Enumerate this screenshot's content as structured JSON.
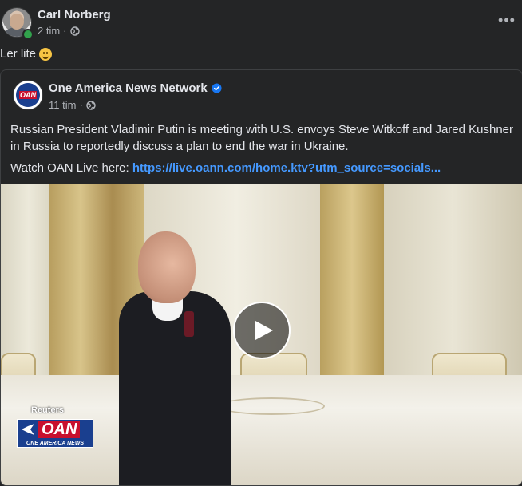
{
  "post": {
    "author_name": "Carl Norberg",
    "time": "2 tim",
    "separator": "·",
    "text": "Ler lite",
    "more_label": "•••"
  },
  "shared": {
    "page_name": "One America News Network",
    "time": "11 tim",
    "separator": "·",
    "body_text": "Russian President Vladimir Putin is meeting with U.S. envoys Steve Witkoff and Jared Kushner in Russia to reportedly discuss a plan to end the war in Ukraine.",
    "watch_prefix": "Watch OAN Live here: ",
    "link_text": "https://live.oann.com/home.ktv?utm_source=socials...",
    "avatar_text": "OAN"
  },
  "video": {
    "source_label": "Reuters",
    "logo_text": "OAN",
    "logo_subtext": "ONE AMERICA NEWS"
  },
  "colors": {
    "background": "#242526",
    "link": "#4599ff",
    "verified": "#1877f2",
    "online": "#31a24c"
  }
}
